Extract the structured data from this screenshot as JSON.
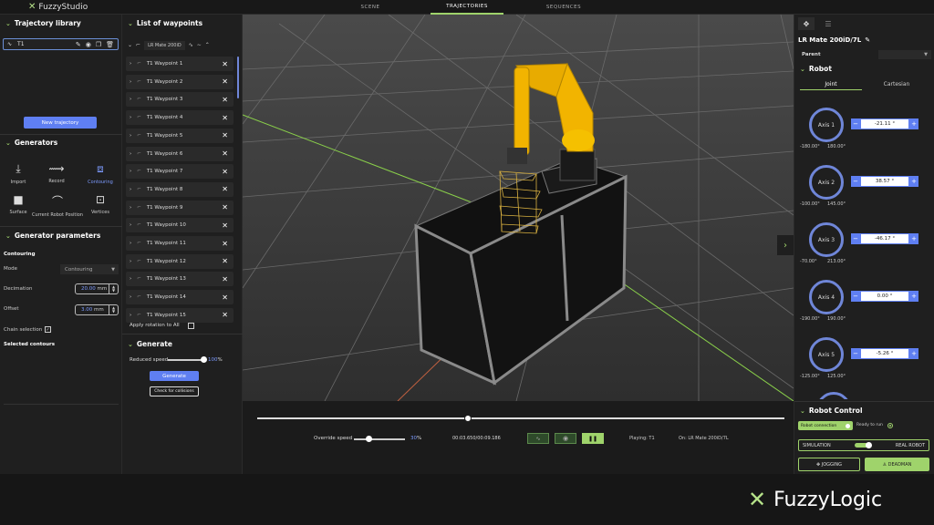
{
  "app": {
    "name": "FuzzyStudio"
  },
  "top_tabs": [
    "SCENE",
    "TRAJECTORIES",
    "SEQUENCES"
  ],
  "left": {
    "traj_title": "Trajectory library",
    "traj_name": "T1",
    "new_traj": "New trajectory",
    "generators_title": "Generators",
    "generators": [
      "Import",
      "Record",
      "Contouring",
      "Surface",
      "Current Robot Position",
      "Vertices"
    ],
    "params_title": "Generator parameters",
    "contouring": "Contouring",
    "mode_label": "Mode",
    "mode_value": "Contouring",
    "decimation_label": "Decimation",
    "decimation_value": "20.00",
    "unit": "mm",
    "offset_label": "Offset",
    "offset_value": "3.00",
    "chain_label": "Chain selection",
    "selected_label": "Selected contours"
  },
  "waypoints": {
    "title": "List of waypoints",
    "robot": "LR Mate 200iD",
    "items": [
      "T1 Waypoint 1",
      "T1 Waypoint 2",
      "T1 Waypoint 3",
      "T1 Waypoint 4",
      "T1 Waypoint 5",
      "T1 Waypoint 6",
      "T1 Waypoint 7",
      "T1 Waypoint 8",
      "T1 Waypoint 9",
      "T1 Waypoint 10",
      "T1 Waypoint 11",
      "T1 Waypoint 12",
      "T1 Waypoint 13",
      "T1 Waypoint 14",
      "T1 Waypoint 15"
    ],
    "apply_rotation": "Apply rotation to All",
    "generate_title": "Generate",
    "reduced_speed": "Reduced speed",
    "reduced_value": "100",
    "pct": "%",
    "generate_btn": "Generate",
    "check_btn": "Check for collisions"
  },
  "playback": {
    "override_label": "Override speed",
    "override_value": "30",
    "pct": "%",
    "time": "00:03.650/00:09.186",
    "playing": "Playing:  T1",
    "on": "On:  LR Mate 200iD/7L",
    "progress": 0.4,
    "override_fraction": 0.3,
    "reduced_fraction": 1.0
  },
  "right": {
    "robot_name": "LR Mate 200iD/7L",
    "parent_label": "Parent",
    "robot_title": "Robot",
    "tab_joint": "Joint",
    "tab_cartesian": "Cartesian",
    "axes": [
      {
        "name": "Axis 1",
        "value": "-21.11 °",
        "min": "-180.00°",
        "max": "180.00°"
      },
      {
        "name": "Axis 2",
        "value": "38.57 °",
        "min": "-100.00°",
        "max": "145.00°"
      },
      {
        "name": "Axis 3",
        "value": "-46.17 °",
        "min": "-70.00°",
        "max": "213.00°"
      },
      {
        "name": "Axis 4",
        "value": "0.00 °",
        "min": "-190.00°",
        "max": "190.00°"
      },
      {
        "name": "Axis 5",
        "value": "-5.26 °",
        "min": "-125.00°",
        "max": "125.00°"
      }
    ],
    "control_title": "Robot Control",
    "connection": "Robot connection",
    "ready": "Ready to run",
    "simulation": "SIMULATION",
    "real_robot": "REAL ROBOT",
    "jogging": "JOGGING",
    "deadman": "DEADMAN"
  },
  "footer": {
    "brand": "FuzzyLogic"
  },
  "colors": {
    "accent": "#9fd36b",
    "blue": "#5f7ff2",
    "robot": "#f2b400"
  }
}
